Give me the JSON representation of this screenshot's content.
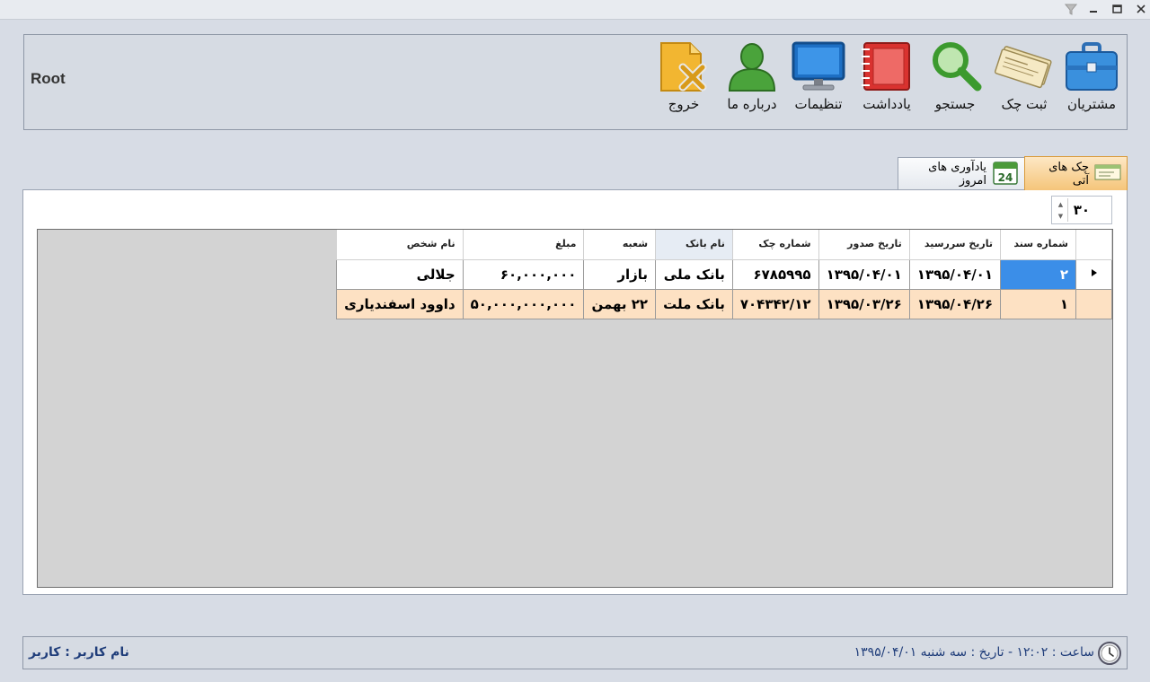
{
  "toolbar": {
    "root_label": "Root",
    "items": [
      {
        "label": "مشتریان",
        "icon": "briefcase-icon"
      },
      {
        "label": "ثبت چک",
        "icon": "cheque-icon"
      },
      {
        "label": "جستجو",
        "icon": "search-icon"
      },
      {
        "label": "یادداشت",
        "icon": "notebook-icon"
      },
      {
        "label": "تنظیمات",
        "icon": "monitor-icon"
      },
      {
        "label": "درباره ما",
        "icon": "user-icon"
      },
      {
        "label": "خروج",
        "icon": "exit-icon"
      }
    ]
  },
  "tabs": {
    "active": "چک های آتی",
    "inactive": "یادآوری های امروز",
    "calendar_day": "24"
  },
  "spinner": {
    "value": "۳۰"
  },
  "table": {
    "headers": {
      "doc_number": "شماره سند",
      "due_date": "تاریخ سررسید",
      "issue_date": "تاریخ صدور",
      "cheque_number": "شماره چک",
      "bank_name": "نام بانک",
      "branch": "شعبه",
      "amount": "مبلغ",
      "person_name": "نام شخص"
    },
    "rows": [
      {
        "doc_number": "۲",
        "due_date": "۱۳۹۵/۰۴/۰۱",
        "issue_date": "۱۳۹۵/۰۴/۰۱",
        "cheque_number": "۶۷۸۵۹۹۵",
        "bank_name": "بانک ملی",
        "branch": "بازار",
        "amount": "۶۰,۰۰۰,۰۰۰",
        "person_name": "جلالی"
      },
      {
        "doc_number": "۱",
        "due_date": "۱۳۹۵/۰۴/۲۶",
        "issue_date": "۱۳۹۵/۰۳/۲۶",
        "cheque_number": "۷۰۴۳۴۲/۱۲",
        "bank_name": "بانک ملت",
        "branch": "۲۲ بهمن",
        "amount": "۵۰,۰۰۰,۰۰۰,۰۰۰",
        "person_name": "داوود اسفندیاری"
      }
    ]
  },
  "status": {
    "user": "نام کاربر : کاربر",
    "datetime": "ساعت : ۱۲:۰۲ - تاریخ : سه شنبه ۱۳۹۵/۰۴/۰۱"
  },
  "colors": {
    "selected_cell": "#3b8ee8",
    "alt_row": "#fde1c3",
    "status_text": "#1f3d7a"
  }
}
